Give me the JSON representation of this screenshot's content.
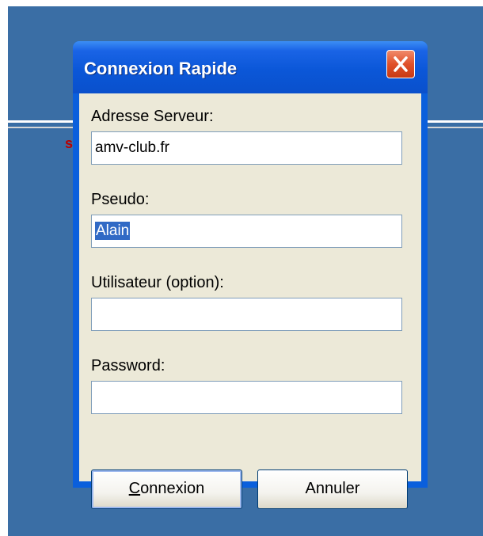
{
  "dialog": {
    "title": "Connexion Rapide",
    "close_icon": "close-icon"
  },
  "fields": {
    "server": {
      "label": "Adresse Serveur:",
      "value": "amv-club.fr"
    },
    "pseudo": {
      "label": "Pseudo:",
      "value": "Alain"
    },
    "user": {
      "label": "Utilisateur (option):",
      "value": ""
    },
    "password": {
      "label": "Password:",
      "value": ""
    }
  },
  "buttons": {
    "connect_label": "Connexion",
    "cancel_label": "Annuler"
  },
  "colors": {
    "desktop": "#3a6ea5",
    "titlebar": "#0a5fdc",
    "dialog_face": "#ece9d8",
    "close": "#e0512a",
    "selection": "#316ac5"
  }
}
